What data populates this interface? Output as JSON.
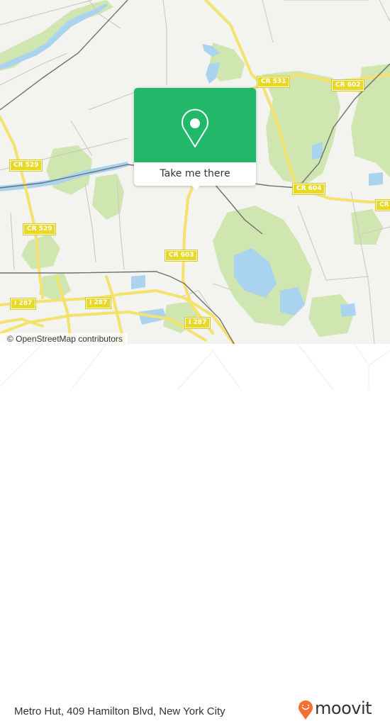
{
  "map": {
    "attribution": "© OpenStreetMap contributors",
    "colors": {
      "land": "#f3f3ef",
      "park": "#cfe6b0",
      "water": "#a9d3ef",
      "highway": "#f4e26e",
      "minor_road": "#c9c9c4",
      "rail": "#707070",
      "shield": "#e8d925"
    },
    "road_labels": [
      {
        "id": "cr531",
        "text": "CR 531"
      },
      {
        "id": "cr602",
        "text": "CR 602"
      },
      {
        "id": "cr529a",
        "text": "CR 529"
      },
      {
        "id": "cr529b",
        "text": "CR 529"
      },
      {
        "id": "cr604",
        "text": "CR 604"
      },
      {
        "id": "cr60x",
        "text": "CR 6"
      },
      {
        "id": "cr603",
        "text": "CR 603"
      },
      {
        "id": "i287a",
        "text": "I 287"
      },
      {
        "id": "i287b",
        "text": "I 287"
      },
      {
        "id": "i287c",
        "text": "I 287"
      }
    ]
  },
  "popup": {
    "icon": "location-pin-icon",
    "button_label": "Take me there",
    "color": "#21b86a"
  },
  "footer": {
    "address": "Metro Hut, 409 Hamilton Blvd, New York City",
    "brand": "moovit",
    "brand_color": "#f36f32"
  }
}
